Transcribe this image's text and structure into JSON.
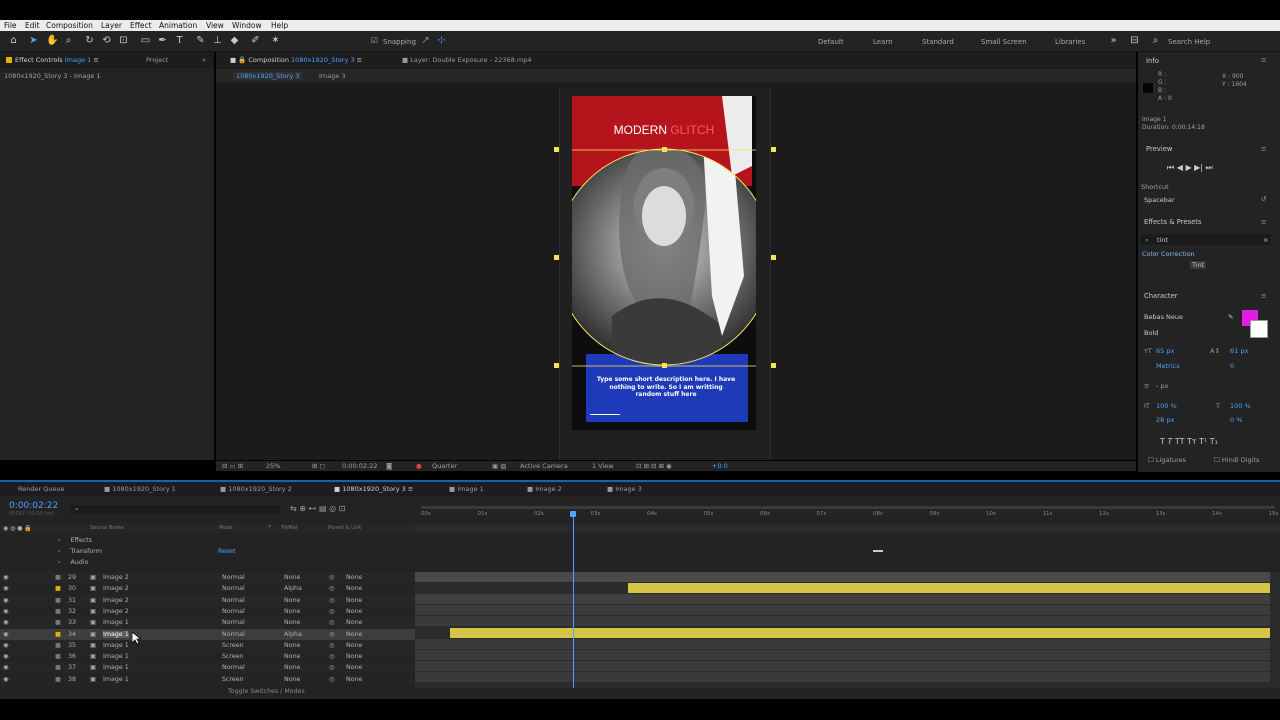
{
  "menu": [
    "File",
    "Edit",
    "Composition",
    "Layer",
    "Effect",
    "Animation",
    "View",
    "Window",
    "Help"
  ],
  "toolbar": {
    "snapping_label": "Snapping",
    "workspaces": [
      "Default",
      "Learn",
      "Standard",
      "Small Screen",
      "Libraries"
    ],
    "search_placeholder": "Search Help"
  },
  "left_panel": {
    "tab_effect_controls": "Effect Controls",
    "tab_effect_controls_layer": "Image 1",
    "tab_project": "Project",
    "breadcrumb": "1080x1920_Story 3 - Image 1"
  },
  "comp_panel": {
    "tab_composition_prefix": "Composition",
    "tab_composition_name": "1080x1920_Story 3",
    "tab_layer": "Layer: Double Exposure - 22368.mp4",
    "subtab_comp": "1080x1920_Story 3",
    "subtab_layer": "Image 3",
    "canvas_title_part1": "MODERN ",
    "canvas_title_part2": "GLITCH",
    "canvas_caption": "Type some short description here. I have nothing to write. So I am writting random stuff here",
    "footer": {
      "zoom": "25%",
      "timecode": "0:00:02:22",
      "resolution": "Quarter",
      "camera": "Active Camera",
      "views": "1 View",
      "exposure": "+0.0"
    }
  },
  "info_panel": {
    "title": "Info",
    "r": "R :",
    "g": "G :",
    "b": "B :",
    "a": "A : 0",
    "x": "X : 900",
    "y": "Y : 1604",
    "layer": "Image 1",
    "duration": "Duration: 0:00:14:18"
  },
  "preview_panel": {
    "title": "Preview",
    "shortcut_label": "Shortcut",
    "shortcut_value": "Spacebar"
  },
  "effects_panel": {
    "title": "Effects & Presets",
    "search_value": "tint",
    "category": "Color Correction",
    "item": "Tint"
  },
  "character_panel": {
    "title": "Character",
    "font": "Bebas Neue",
    "style": "Bold",
    "font_size": "65 px",
    "leading": "61 px",
    "kerning": "Metrics",
    "tracking": "0",
    "stroke": "- px",
    "vert_scale": "100 %",
    "horiz_scale": "100 %",
    "baseline": "28 px",
    "tsume": "0 %",
    "ligatures": "Ligatures",
    "hindi_digits": "Hindi Digits",
    "fill_color": "#e11ee0"
  },
  "timeline": {
    "tabs": [
      "Render Queue",
      "1080x1920_Story 1",
      "1080x1920_Story 2",
      "1080x1920_Story 3",
      "Image 1",
      "Image 2",
      "Image 3"
    ],
    "timecode": "0:00:02:22",
    "timecode_sub": "00082 (30.00 fps)",
    "col_headers": {
      "source": "Source Name",
      "mode": "Mode",
      "t": "T",
      "trkmat": "TrkMat",
      "parent": "Parent & Link"
    },
    "props": [
      {
        "name": "Effects"
      },
      {
        "name": "Transform",
        "value": "Reset"
      },
      {
        "name": "Audio"
      }
    ],
    "ruler": [
      "00s",
      "01s",
      "02s",
      "03s",
      "04s",
      "05s",
      "06s",
      "07s",
      "08s",
      "09s",
      "10s",
      "11s",
      "12s",
      "13s",
      "14s",
      "15s"
    ],
    "layers": [
      {
        "num": "29",
        "name": "Image 2",
        "mode": "Normal",
        "trkmat": "None",
        "parent": "None"
      },
      {
        "num": "30",
        "name": "Image 2",
        "mode": "Normal",
        "trkmat": "Alpha",
        "parent": "None"
      },
      {
        "num": "31",
        "name": "Image 2",
        "mode": "Normal",
        "trkmat": "None",
        "parent": "None"
      },
      {
        "num": "32",
        "name": "Image 2",
        "mode": "Normal",
        "trkmat": "None",
        "parent": "None"
      },
      {
        "num": "33",
        "name": "Image 1",
        "mode": "Normal",
        "trkmat": "None",
        "parent": "None"
      },
      {
        "num": "34",
        "name": "Image 1",
        "mode": "Normal",
        "trkmat": "Alpha",
        "parent": "None"
      },
      {
        "num": "35",
        "name": "Image 1",
        "mode": "Screen",
        "trkmat": "None",
        "parent": "None"
      },
      {
        "num": "36",
        "name": "Image 1",
        "mode": "Screen",
        "trkmat": "None",
        "parent": "None"
      },
      {
        "num": "37",
        "name": "Image 1",
        "mode": "Normal",
        "trkmat": "None",
        "parent": "None"
      },
      {
        "num": "38",
        "name": "Image 1",
        "mode": "Screen",
        "trkmat": "None",
        "parent": "None"
      }
    ],
    "footer_label": "Toggle Switches / Modes"
  }
}
